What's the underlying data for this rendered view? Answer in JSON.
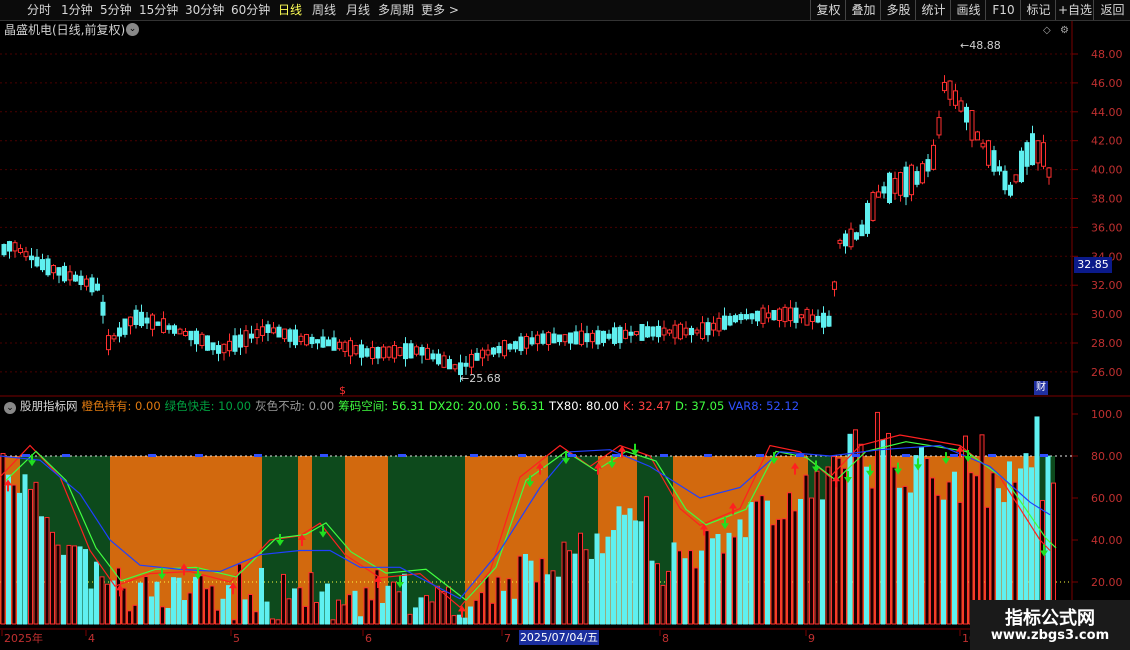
{
  "toolbar": {
    "periods": [
      "分时",
      "1分钟",
      "5分钟",
      "15分钟",
      "30分钟",
      "60分钟",
      "日线",
      "周线",
      "月线",
      "多周期",
      "更多 >"
    ],
    "active_period": "日线",
    "right_buttons": [
      "复权",
      "叠加",
      "多股",
      "统计",
      "画线",
      "F10",
      "标记",
      "+自选",
      "返回"
    ]
  },
  "stock": {
    "title": "晶盛机电(日线,前复权)",
    "high_label": "48.88",
    "low_label": "25.68",
    "current_price": "32.85",
    "cai_badge": "财",
    "dollar_mark": "$"
  },
  "price_axis": [
    "48.00",
    "46.00",
    "44.00",
    "42.00",
    "40.00",
    "38.00",
    "36.00",
    "34.00",
    "32.00",
    "30.00",
    "28.00",
    "26.00"
  ],
  "indicator": {
    "name": "股朋指标网",
    "legend": [
      {
        "text": "橙色持有: 0.00",
        "color": "#e07a10"
      },
      {
        "text": "绿色快走: 10.00",
        "color": "#00a040"
      },
      {
        "text": "灰色不动: 0.00",
        "color": "#9a9a9a"
      },
      {
        "text": "筹码空间: 56.31",
        "color": "#40ff40"
      },
      {
        "text": "DX20: 20.00",
        "color": "#40ff40"
      },
      {
        "text": ": 56.31",
        "color": "#40ff40"
      },
      {
        "text": "TX80: 80.00",
        "color": "#ffffff"
      },
      {
        "text": "K: 32.47",
        "color": "#ff4040"
      },
      {
        "text": "D: 37.05",
        "color": "#40ff40"
      },
      {
        "text": "VAR8: 52.12",
        "color": "#3050ff"
      }
    ],
    "axis": [
      "100.0",
      "80.00",
      "60.00",
      "40.00",
      "20.00"
    ]
  },
  "date_axis": {
    "labels": [
      "2025年",
      "4",
      "5",
      "6",
      "7",
      "8",
      "9",
      "10"
    ],
    "highlight": "2025/07/04/五"
  },
  "watermark": {
    "title": "指标公式网",
    "url": "www.zbgs3.com"
  },
  "colors": {
    "up": "#ff3030",
    "down": "#5ff0f0",
    "orange": "#d2690e",
    "green_bg": "#0d4a1c",
    "ma_blue": "#2040ff"
  }
}
